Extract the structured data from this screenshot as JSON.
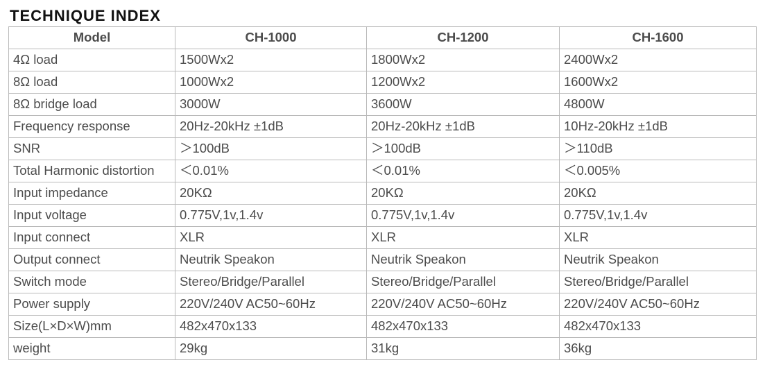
{
  "title": "TECHNIQUE INDEX",
  "headers": [
    "Model",
    "CH-1000",
    "CH-1200",
    "CH-1600"
  ],
  "rows": [
    {
      "label": "4Ω load",
      "v": [
        "1500Wx2",
        "1800Wx2",
        "2400Wx2"
      ]
    },
    {
      "label": "8Ω load",
      "v": [
        "1000Wx2",
        "1200Wx2",
        "1600Wx2"
      ]
    },
    {
      "label": "8Ω bridge load",
      "v": [
        "3000W",
        "3600W",
        "4800W"
      ]
    },
    {
      "label": "Frequency response",
      "v": [
        "20Hz-20kHz ±1dB",
        "20Hz-20kHz ±1dB",
        "10Hz-20kHz ±1dB"
      ]
    },
    {
      "label": "SNR",
      "v": [
        "＞100dB",
        "＞100dB",
        "＞110dB"
      ]
    },
    {
      "label": "Total Harmonic distortion",
      "v": [
        "＜0.01%",
        "＜0.01%",
        "＜0.005%"
      ]
    },
    {
      "label": "Input impedance",
      "v": [
        "20KΩ",
        "20KΩ",
        "20KΩ"
      ]
    },
    {
      "label": "Input voltage",
      "v": [
        "0.775V,1v,1.4v",
        "0.775V,1v,1.4v",
        "0.775V,1v,1.4v"
      ]
    },
    {
      "label": "Input connect",
      "v": [
        "XLR",
        "XLR",
        "XLR"
      ]
    },
    {
      "label": "Output connect",
      "v": [
        "Neutrik Speakon",
        "Neutrik Speakon",
        "Neutrik Speakon"
      ]
    },
    {
      "label": "Switch mode",
      "v": [
        "Stereo/Bridge/Parallel",
        "Stereo/Bridge/Parallel",
        "Stereo/Bridge/Parallel"
      ]
    },
    {
      "label": "Power supply",
      "v": [
        "220V/240V AC50~60Hz",
        "220V/240V AC50~60Hz",
        "220V/240V AC50~60Hz"
      ]
    },
    {
      "label": "Size(L×D×W)mm",
      "v": [
        "482x470x133",
        "482x470x133",
        "482x470x133"
      ]
    },
    {
      "label": "weight",
      "v": [
        "29kg",
        "31kg",
        "36kg"
      ]
    }
  ],
  "chart_data": {
    "type": "table",
    "title": "TECHNIQUE INDEX",
    "columns": [
      "Model",
      "CH-1000",
      "CH-1200",
      "CH-1600"
    ],
    "data": [
      [
        "4Ω load",
        "1500Wx2",
        "1800Wx2",
        "2400Wx2"
      ],
      [
        "8Ω load",
        "1000Wx2",
        "1200Wx2",
        "1600Wx2"
      ],
      [
        "8Ω bridge load",
        "3000W",
        "3600W",
        "4800W"
      ],
      [
        "Frequency response",
        "20Hz-20kHz ±1dB",
        "20Hz-20kHz ±1dB",
        "10Hz-20kHz ±1dB"
      ],
      [
        "SNR",
        "＞100dB",
        "＞100dB",
        "＞110dB"
      ],
      [
        "Total Harmonic distortion",
        "＜0.01%",
        "＜0.01%",
        "＜0.005%"
      ],
      [
        "Input impedance",
        "20KΩ",
        "20KΩ",
        "20KΩ"
      ],
      [
        "Input voltage",
        "0.775V,1v,1.4v",
        "0.775V,1v,1.4v",
        "0.775V,1v,1.4v"
      ],
      [
        "Input connect",
        "XLR",
        "XLR",
        "XLR"
      ],
      [
        "Output connect",
        "Neutrik Speakon",
        "Neutrik Speakon",
        "Neutrik Speakon"
      ],
      [
        "Switch mode",
        "Stereo/Bridge/Parallel",
        "Stereo/Bridge/Parallel",
        "Stereo/Bridge/Parallel"
      ],
      [
        "Power supply",
        "220V/240V AC50~60Hz",
        "220V/240V AC50~60Hz",
        "220V/240V AC50~60Hz"
      ],
      [
        "Size(L×D×W)mm",
        "482x470x133",
        "482x470x133",
        "482x470x133"
      ],
      [
        "weight",
        "29kg",
        "31kg",
        "36kg"
      ]
    ]
  }
}
